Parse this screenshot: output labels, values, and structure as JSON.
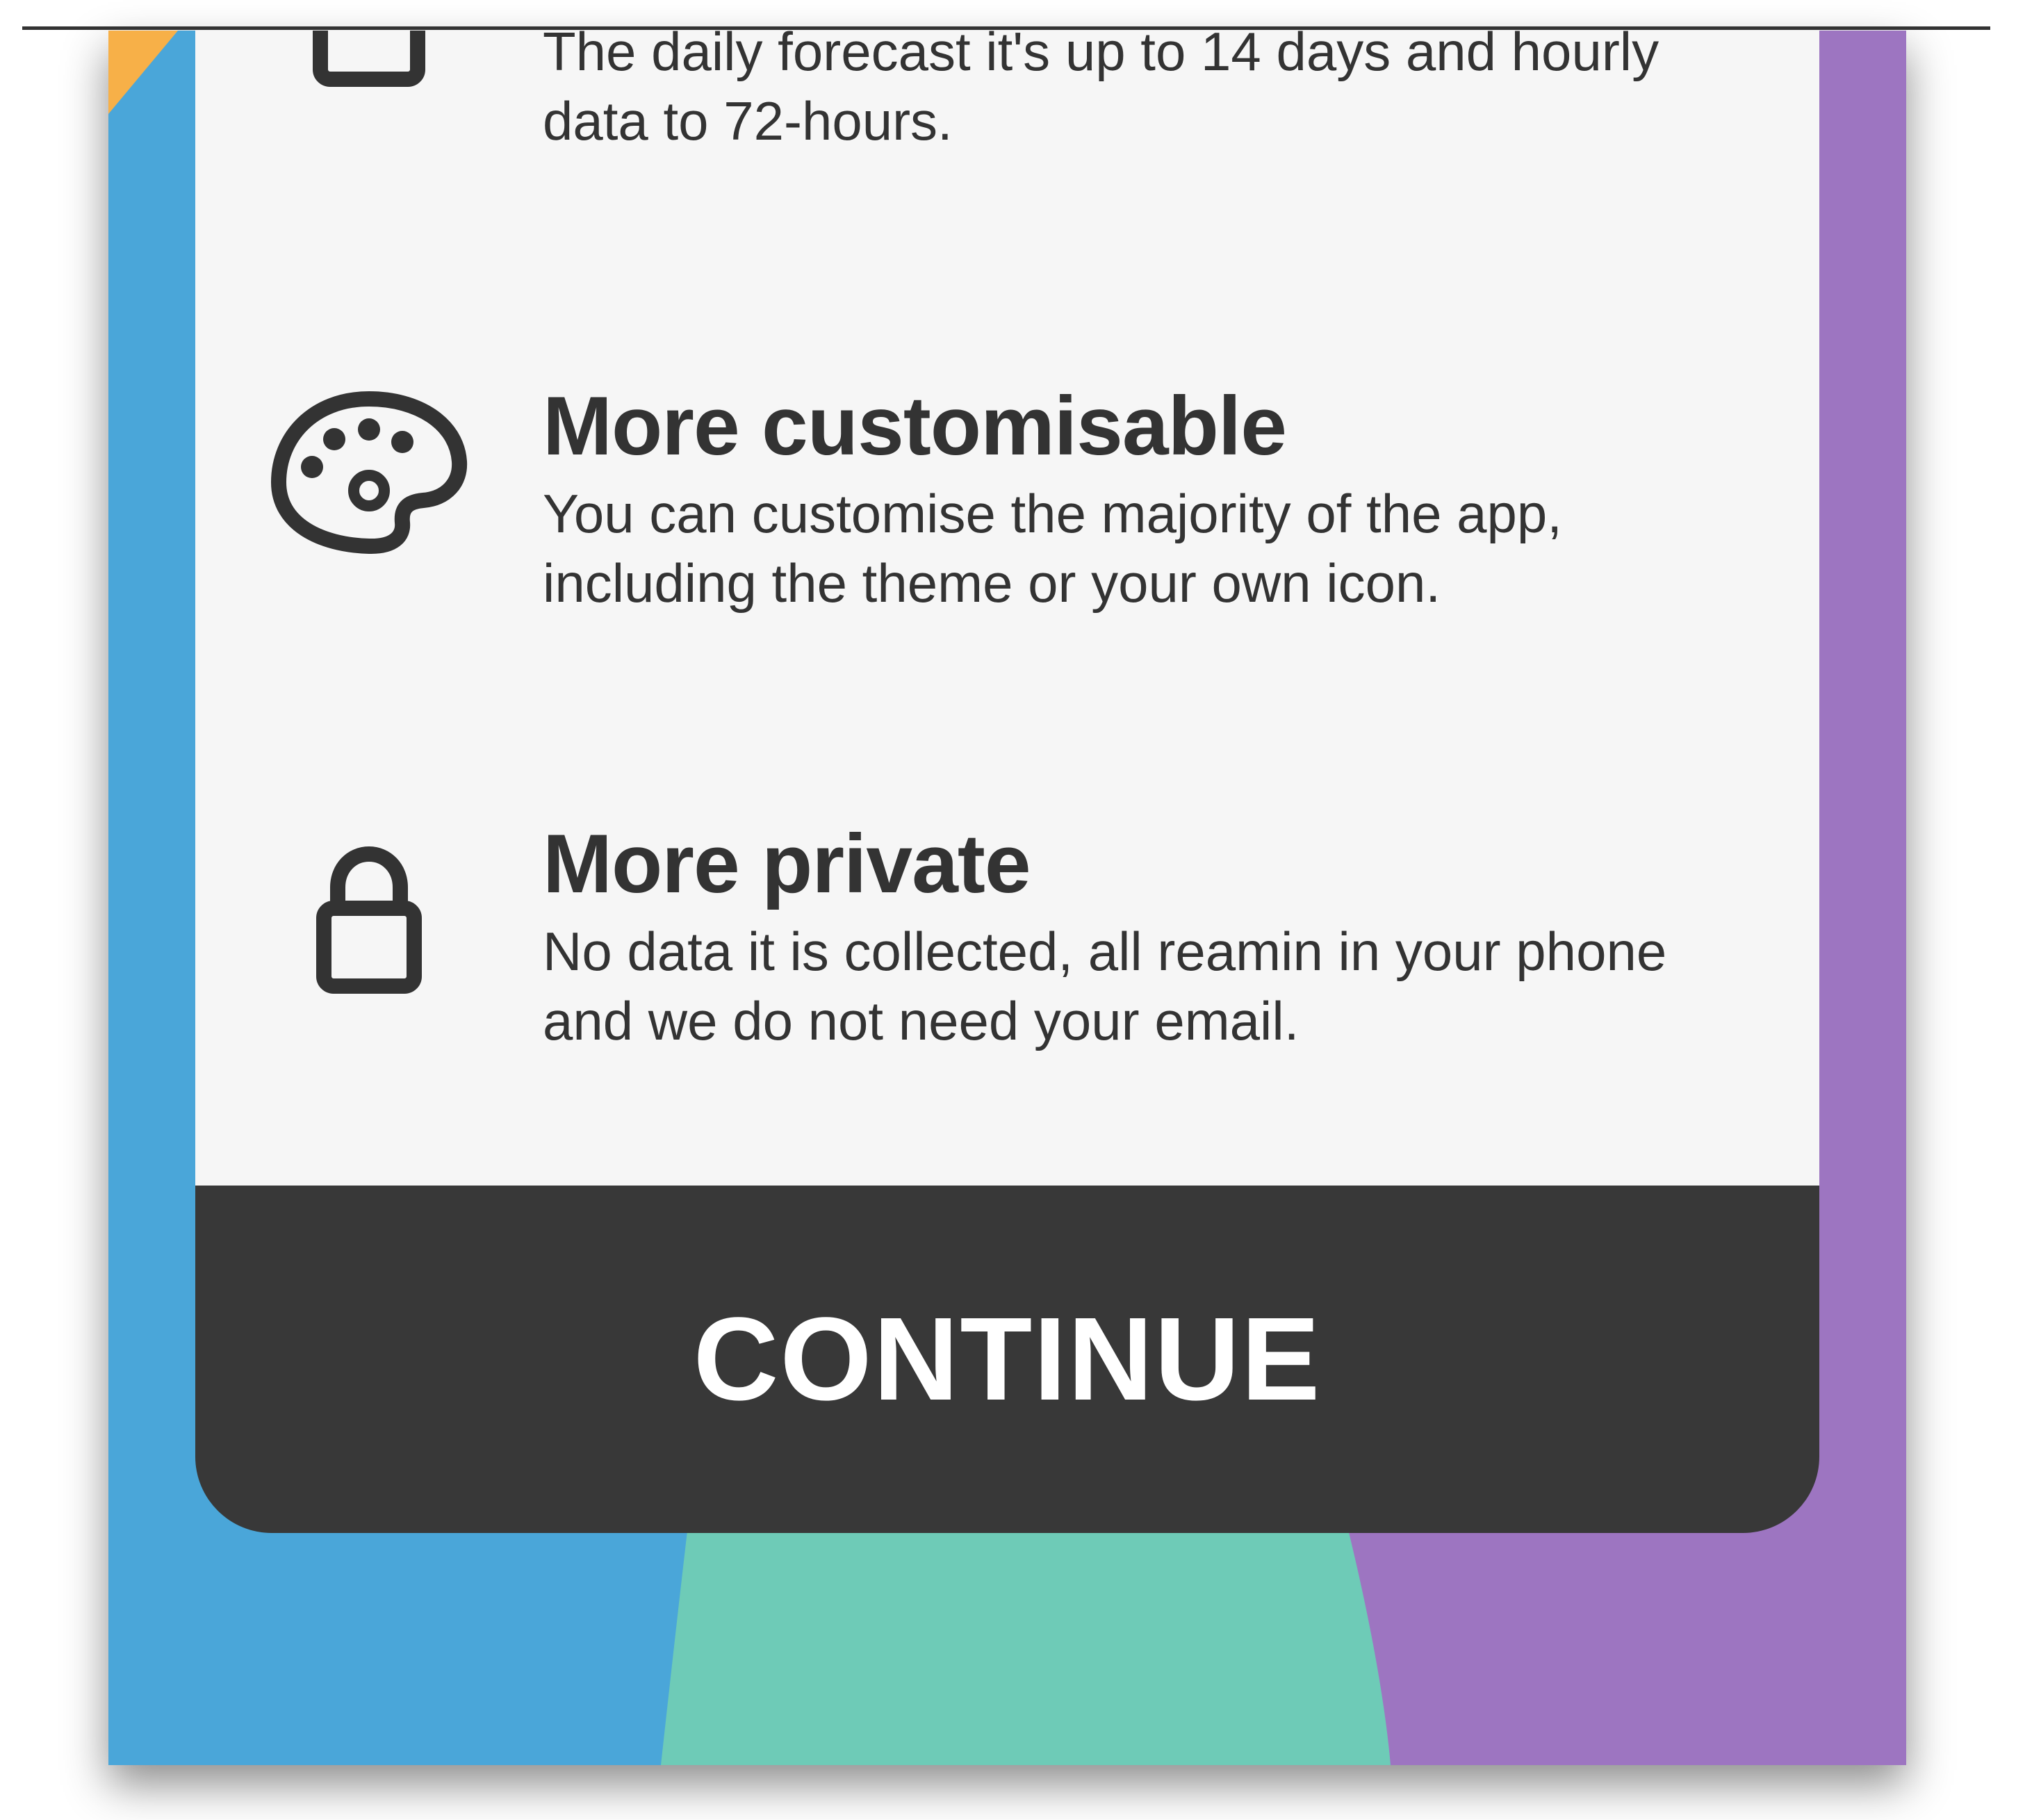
{
  "features": [
    {
      "icon": "calendar-icon",
      "title": "",
      "description": "The daily forecast it's up to 14 days and hourly data to 72-hours."
    },
    {
      "icon": "palette-icon",
      "title": "More customisable",
      "description": "You can customise the majority of the app, including the theme or your own icon."
    },
    {
      "icon": "lock-icon",
      "title": "More private",
      "description": "No data it is collected, all reamin in your phone and we do not need your email."
    }
  ],
  "continue_button": {
    "label": "CONTINUE"
  },
  "colors": {
    "card_background": "#f6f6f6",
    "text": "#333333",
    "button_background": "#383838",
    "button_text": "#ffffff",
    "background_blue": "#4aa6d9",
    "background_teal": "#6ecbb7",
    "background_purple": "#9d75c1",
    "background_orange": "#f7b048"
  }
}
